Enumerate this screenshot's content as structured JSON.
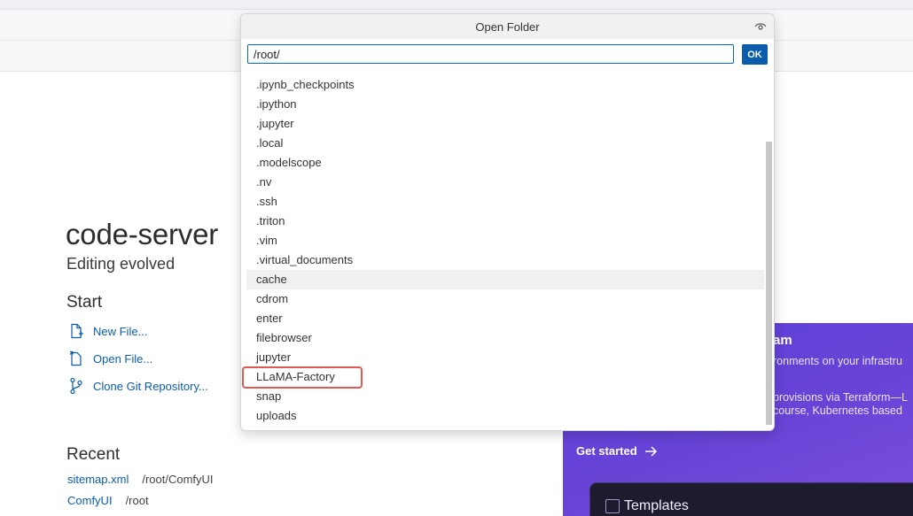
{
  "dialog": {
    "title": "Open Folder",
    "path_value": "/root/",
    "ok_label": "OK",
    "items": [
      ".ipynb_checkpoints",
      ".ipython",
      ".jupyter",
      ".local",
      ".modelscope",
      ".nv",
      ".ssh",
      ".triton",
      ".vim",
      ".virtual_documents",
      "cache",
      "cdrom",
      "enter",
      "filebrowser",
      "jupyter",
      "LLaMA-Factory",
      "snap",
      "uploads"
    ],
    "hovered_item": "cache",
    "highlighted_item": "LLaMA-Factory"
  },
  "welcome": {
    "title": "code-server",
    "subtitle": "Editing evolved",
    "start_heading": "Start",
    "start_items": [
      {
        "label": "New File...",
        "icon": "new-file-icon"
      },
      {
        "label": "Open File...",
        "icon": "open-file-icon"
      },
      {
        "label": "Clone Git Repository...",
        "icon": "git-branch-icon"
      }
    ],
    "recent_heading": "Recent",
    "recent": [
      {
        "name": "sitemap.xml",
        "path": "/root/ComfyUI"
      },
      {
        "name": "ComfyUI",
        "path": "/root"
      }
    ]
  },
  "promo": {
    "title_fragment": "am",
    "line1": "ronments on your infrastru",
    "line2": "provisions via Terraform—L",
    "line3": "course, Kubernetes based",
    "cta": "Get started",
    "templates_label": "Templates"
  },
  "colors": {
    "accent": "#0b5cad",
    "focus_border": "#0069bf",
    "highlight_box": "#e05a4f",
    "promo_bg": "#6844d6"
  }
}
